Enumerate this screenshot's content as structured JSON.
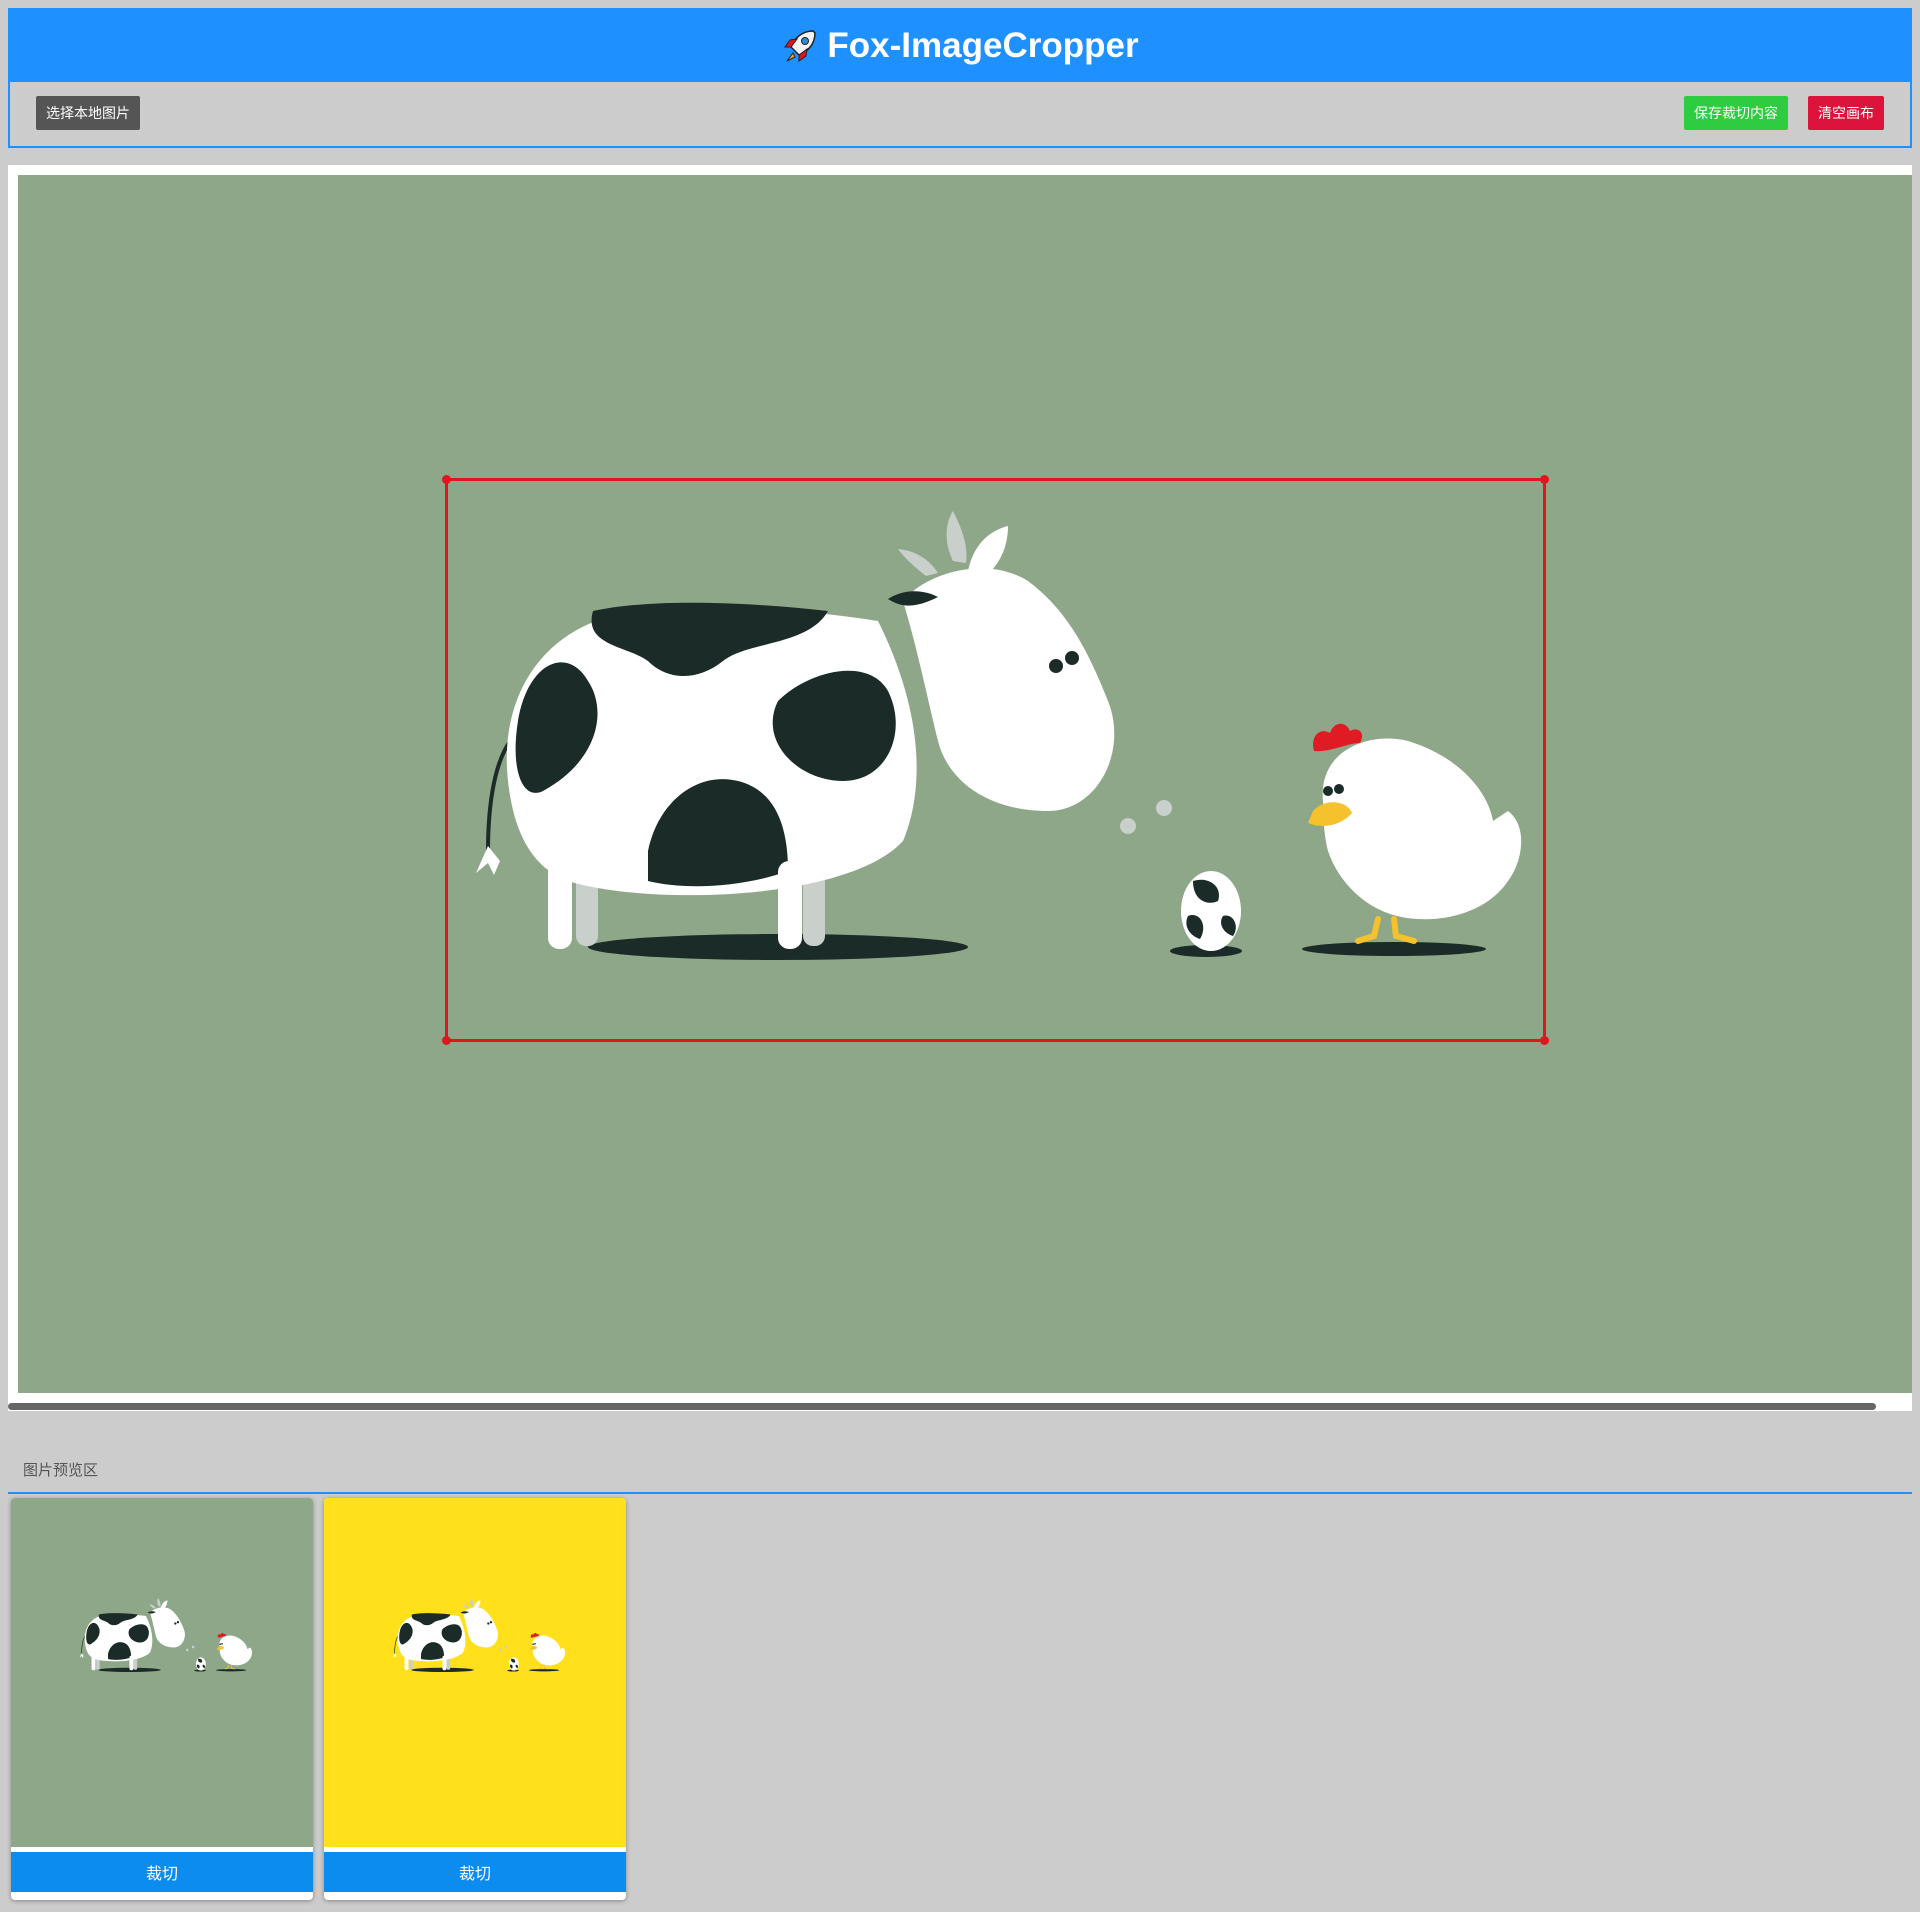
{
  "app": {
    "title": "Fox-ImageCropper",
    "title_icon": "rocket-icon",
    "accent_color": "#1e90ff"
  },
  "toolbar": {
    "select_label": "选择本地图片",
    "save_label": "保存裁切内容",
    "clear_label": "清空画布",
    "select_color": "#555555",
    "save_color": "#2ecc40",
    "clear_color": "#dc143c"
  },
  "canvas": {
    "background_color": "#8ea788",
    "crop_border_color": "#e0161c"
  },
  "preview": {
    "section_label": "图片预览区",
    "items": [
      {
        "background_color": "#8ea788",
        "button_label": "裁切"
      },
      {
        "background_color": "#ffe01a",
        "button_label": "裁切"
      }
    ]
  }
}
